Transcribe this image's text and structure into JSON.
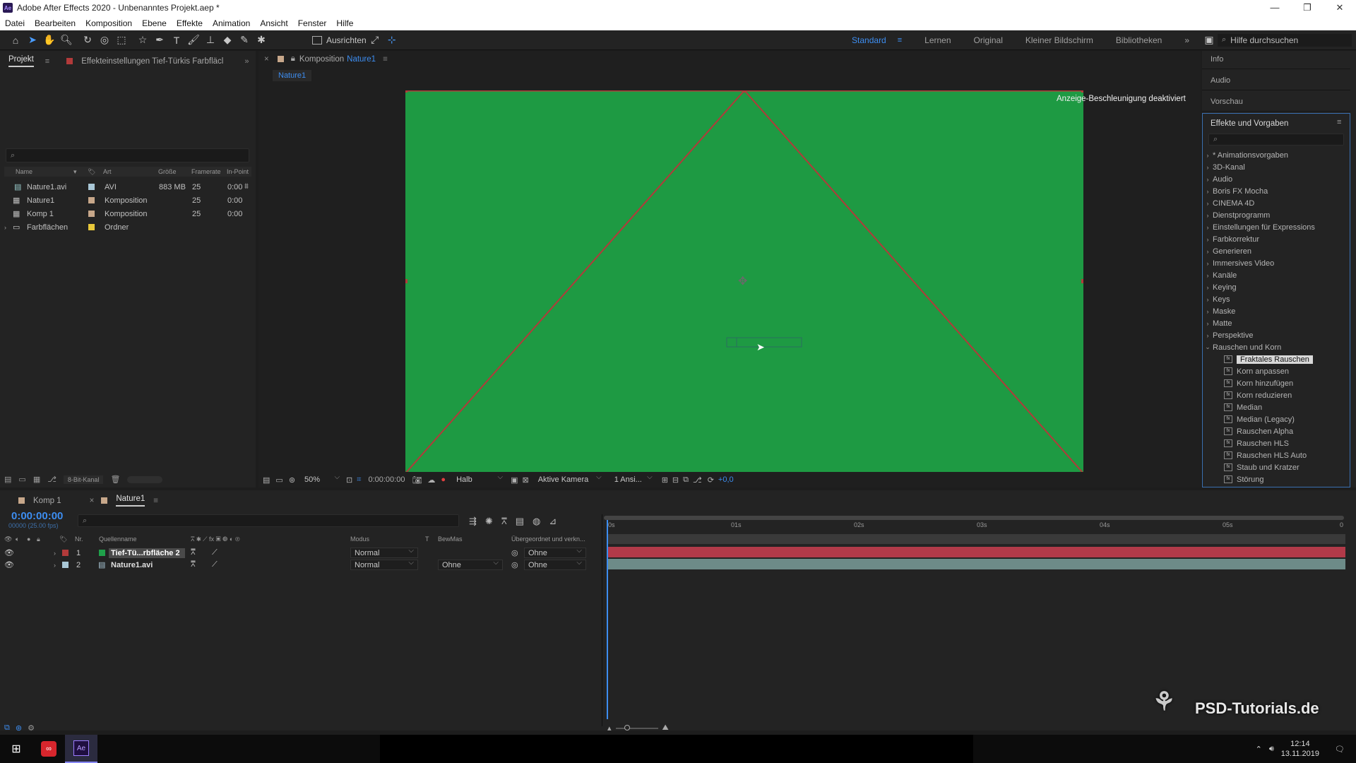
{
  "titlebar": {
    "title": "Adobe After Effects 2020 - Unbenanntes Projekt.aep *",
    "app_icon": "Ae"
  },
  "menu": [
    "Datei",
    "Bearbeiten",
    "Komposition",
    "Ebene",
    "Effekte",
    "Animation",
    "Ansicht",
    "Fenster",
    "Hilfe"
  ],
  "toolbar": {
    "ausrichten_label": "Ausrichten",
    "workspaces": [
      "Standard",
      "Lernen",
      "Original",
      "Kleiner Bildschirm",
      "Bibliotheken"
    ],
    "active_workspace": "Standard",
    "help_placeholder": "Hilfe durchsuchen"
  },
  "project_panel": {
    "tab_label": "Projekt",
    "effect_settings_tab": "Effekteinstellungen Tief-Türkis Farbfläcl",
    "columns": [
      "Name",
      "Art",
      "Größe",
      "Framerate",
      "In-Point"
    ],
    "items": [
      {
        "name": "Nature1.avi",
        "type": "AVI",
        "size": "883 MB",
        "framerate": "25",
        "inpoint": "0:00",
        "label_color": "#a9c7d6",
        "icon": "footage-icon"
      },
      {
        "name": "Nature1",
        "type": "Komposition",
        "size": "",
        "framerate": "25",
        "inpoint": "0:00",
        "label_color": "#c7a78a",
        "icon": "composition-icon"
      },
      {
        "name": "Komp 1",
        "type": "Komposition",
        "size": "",
        "framerate": "25",
        "inpoint": "0:00",
        "label_color": "#c7a78a",
        "icon": "composition-icon"
      },
      {
        "name": "Farbflächen",
        "type": "Ordner",
        "size": "",
        "framerate": "",
        "inpoint": "",
        "label_color": "#e8c83a",
        "icon": "folder-icon"
      }
    ],
    "bit_depth": "8-Bit-Kanal"
  },
  "comp_panel": {
    "tab_prefix": "Komposition",
    "tab_name": "Nature1",
    "sub_tab": "Nature1",
    "gpu_notice": "Anzeige-Beschleunigung deaktiviert",
    "comp_bg_color": "#1e9a43",
    "mask_color": "#b23a3a",
    "footer": {
      "zoom": "50%",
      "timecode": "0:00:00:00",
      "resolution": "Halb",
      "camera": "Aktive Kamera",
      "views": "1 Ansi...",
      "exposure": "+0,0"
    }
  },
  "right_panels": {
    "tabs": [
      "Info",
      "Audio",
      "Vorschau"
    ],
    "effects_title": "Effekte und Vorgaben",
    "categories": [
      "* Animationsvorgaben",
      "3D-Kanal",
      "Audio",
      "Boris FX Mocha",
      "CINEMA 4D",
      "Dienstprogramm",
      "Einstellungen für Expressions",
      "Farbkorrektur",
      "Generieren",
      "Immersives Video",
      "Kanäle",
      "Keying",
      "Keys",
      "Maske",
      "Matte",
      "Perspektive",
      "Rauschen und Korn"
    ],
    "expanded_items": [
      "Fraktales Rauschen",
      "Korn anpassen",
      "Korn hinzufügen",
      "Korn reduzieren",
      "Median",
      "Median (Legacy)",
      "Rauschen Alpha",
      "Rauschen HLS",
      "Rauschen HLS Auto",
      "Staub und Kratzer",
      "Störung"
    ],
    "selected_item": "Fraktales Rauschen"
  },
  "timeline": {
    "tabs": [
      "Komp 1",
      "Nature1"
    ],
    "active_tab": "Nature1",
    "timecode": "0:00:00:00",
    "timecode_sub": "00000 (25.00 fps)",
    "columns": {
      "nr": "Nr.",
      "source": "Quellenname",
      "mode": "Modus",
      "t": "T",
      "trkmat": "BewMas",
      "parent": "Übergeordnet und verkn..."
    },
    "ruler": [
      "0s",
      "01s",
      "02s",
      "03s",
      "04s",
      "05s",
      "0"
    ],
    "layers": [
      {
        "nr": "1",
        "name": "Tief-Tü...rbfläche 2",
        "mode": "Normal",
        "trkmat": "",
        "parent": "Ohne",
        "label_color": "#b23a3a",
        "bar_color": "#b23a49",
        "icon_color": "#1fa04a"
      },
      {
        "nr": "2",
        "name": "Nature1.avi",
        "mode": "Normal",
        "trkmat": "Ohne",
        "parent": "Ohne",
        "label_color": "#a9c7d6",
        "bar_color": "#6d8b88",
        "icon_color": "#a9c7d6"
      }
    ]
  },
  "taskbar": {
    "time": "12:14",
    "date": "13.11.2019"
  },
  "watermark": "PSD-Tutorials.de"
}
